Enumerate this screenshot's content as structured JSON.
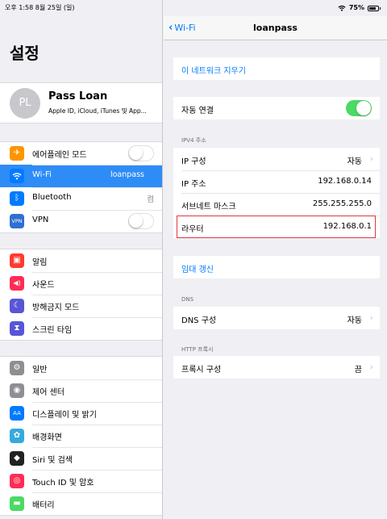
{
  "status_bar": {
    "time_date": "오후 1:58   8월 25일 (일)",
    "battery": "75%",
    "battery_level": 0.75
  },
  "left": {
    "title": "설정",
    "profile": {
      "initials": "PL",
      "name": "Pass Loan",
      "subtitle": "Apple ID, iCloud, iTunes 및 App..."
    },
    "group1": [
      {
        "label": "에어플레인 모드",
        "icon": "airplane-icon",
        "color": "#ff9500",
        "glyph": "✈"
      },
      {
        "label": "Wi-Fi",
        "icon": "wifi-icon",
        "color": "#007aff",
        "glyph": "◠",
        "value": "loanpass"
      },
      {
        "label": "Bluetooth",
        "icon": "bluetooth-icon",
        "color": "#007aff",
        "glyph": "ᛒ",
        "value": "켬"
      },
      {
        "label": "VPN",
        "icon": "vpn-icon",
        "color": "#2f6fd1",
        "glyph": "VPN"
      }
    ],
    "group2": [
      {
        "label": "알림",
        "icon": "notifications-icon",
        "color": "#ff3b30",
        "glyph": "▣"
      },
      {
        "label": "사운드",
        "icon": "sound-icon",
        "color": "#ff2d55",
        "glyph": "◀)"
      },
      {
        "label": "방해금지 모드",
        "icon": "moon-icon",
        "color": "#5856d6",
        "glyph": "☾"
      },
      {
        "label": "스크린 타임",
        "icon": "hourglass-icon",
        "color": "#5856d6",
        "glyph": "⧗"
      }
    ],
    "group3": [
      {
        "label": "일반",
        "icon": "gear-icon",
        "color": "#8e8e93",
        "glyph": "⚙"
      },
      {
        "label": "제어 센터",
        "icon": "control-center-icon",
        "color": "#8e8e93",
        "glyph": "◉"
      },
      {
        "label": "디스플레이 및 밝기",
        "icon": "display-icon",
        "color": "#007aff",
        "glyph": "AA"
      },
      {
        "label": "배경화면",
        "icon": "wallpaper-icon",
        "color": "#34aadc",
        "glyph": "✿"
      },
      {
        "label": "Siri 및 검색",
        "icon": "siri-icon",
        "color": "#222222",
        "glyph": "◆"
      },
      {
        "label": "Touch ID 및 암호",
        "icon": "fingerprint-icon",
        "color": "#ff2d55",
        "glyph": "◎"
      },
      {
        "label": "배터리",
        "icon": "battery-icon",
        "color": "#4cd964",
        "glyph": "▬"
      }
    ]
  },
  "right": {
    "back_label": "Wi-Fi",
    "title": "loanpass",
    "forget": "이 네트워크 지우기",
    "auto_join": "자동 연결",
    "ipv4_header": "IPV4 주소",
    "ipv4": [
      {
        "label": "IP 구성",
        "value": "자동"
      },
      {
        "label": "IP 주소",
        "value": "192.168.0.14"
      },
      {
        "label": "서브네트 마스크",
        "value": "255.255.255.0"
      },
      {
        "label": "라우터",
        "value": "192.168.0.1"
      }
    ],
    "renew": "임대 갱신",
    "dns_header": "DNS",
    "dns": {
      "label": "DNS 구성",
      "value": "자동"
    },
    "proxy_header": "HTTP 프록시",
    "proxy": {
      "label": "프록시 구성",
      "value": "끔"
    }
  }
}
